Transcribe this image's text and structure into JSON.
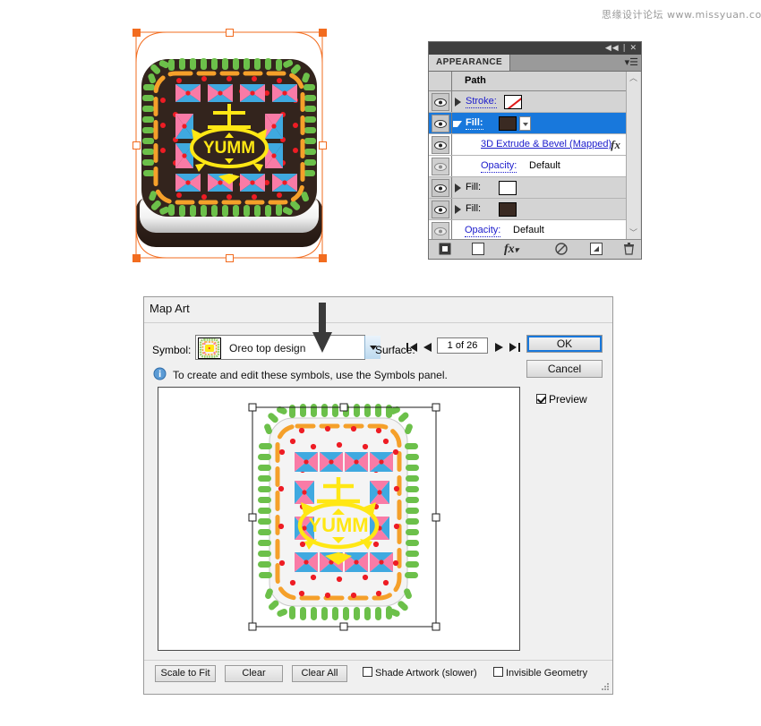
{
  "watermark": "思缘设计论坛  www.missyuan.com",
  "artboard": {
    "name": "3d-oreo-cookie-icon",
    "selection_color": "#f26c1f"
  },
  "appearance_panel": {
    "tab_label": "APPEARANCE",
    "collapse_icon": "double-chevron-left-icon",
    "close_icon": "close-icon",
    "menu_icon": "panel-menu-icon",
    "object_type": "Path",
    "rows": [
      {
        "id": "stroke",
        "label": "Stroke:",
        "swatch": "none",
        "selected": false,
        "expanded": false,
        "visible": true
      },
      {
        "id": "fill-1",
        "label": "Fill:",
        "swatch": "#3a2a22",
        "selected": true,
        "expanded": true,
        "visible": true
      },
      {
        "id": "effect-3d",
        "label": "3D Extrude & Bevel (Mapped)",
        "badge": "fx",
        "selected": false,
        "visible": true
      },
      {
        "id": "opacity-1",
        "label": "Opacity:",
        "value": "Default",
        "selected": false,
        "visible": true
      },
      {
        "id": "fill-2",
        "label": "Fill:",
        "swatch": "#ffffff",
        "selected": false,
        "expanded": false,
        "visible": true
      },
      {
        "id": "fill-3",
        "label": "Fill:",
        "swatch": "#3a2a22",
        "selected": false,
        "expanded": false,
        "visible": true
      },
      {
        "id": "opacity-2",
        "label": "Opacity:",
        "value": "Default",
        "selected": false,
        "visible": true
      }
    ],
    "footer_icons": [
      "add-new-stroke-icon",
      "add-new-fill-icon",
      "add-new-effect-icon",
      "clear-appearance-icon",
      "duplicate-item-icon",
      "delete-item-icon"
    ],
    "scrollbar": {
      "up_arrow": "chevron-up-icon",
      "down_arrow": "chevron-down-icon"
    }
  },
  "map_art_dialog": {
    "title": "Map Art",
    "symbol_label": "Symbol:",
    "symbol_value": "Oreo top design",
    "symbol_dropdown_icon": "chevron-down-icon",
    "surface_label": "Surface:",
    "surface_value": "1 of 26",
    "nav_first_icon": "first-surface-icon",
    "nav_prev_icon": "previous-surface-icon",
    "nav_next_icon": "next-surface-icon",
    "nav_last_icon": "last-surface-icon",
    "hint_icon": "info-icon",
    "hint_text": "To create and edit these symbols, use the Symbols panel.",
    "ok_label": "OK",
    "cancel_label": "Cancel",
    "preview_label": "Preview",
    "preview_checked": true,
    "footer_buttons": [
      {
        "id": "scale-to-fit",
        "label": "Scale to Fit"
      },
      {
        "id": "clear",
        "label": "Clear"
      },
      {
        "id": "clear-all",
        "label": "Clear All"
      }
    ],
    "footer_checkboxes": [
      {
        "id": "shade-artwork",
        "label": "Shade Artwork (slower)",
        "checked": false
      },
      {
        "id": "invisible-geometry",
        "label": "Invisible Geometry",
        "checked": false
      }
    ],
    "annotation_arrow": "down-arrow-annotation",
    "resize_grip_icon": "resize-grip-icon"
  },
  "artwork": {
    "center_text": "YUMM",
    "colors": {
      "cookie_dark": "#33241d",
      "cream": "#f4f4f4",
      "green": "#6cc04a",
      "orange": "#f5a02a",
      "pink": "#f97ba6",
      "blue": "#3fa9e0",
      "red_dot": "#ee1c24",
      "yellow": "#ffe714"
    }
  }
}
